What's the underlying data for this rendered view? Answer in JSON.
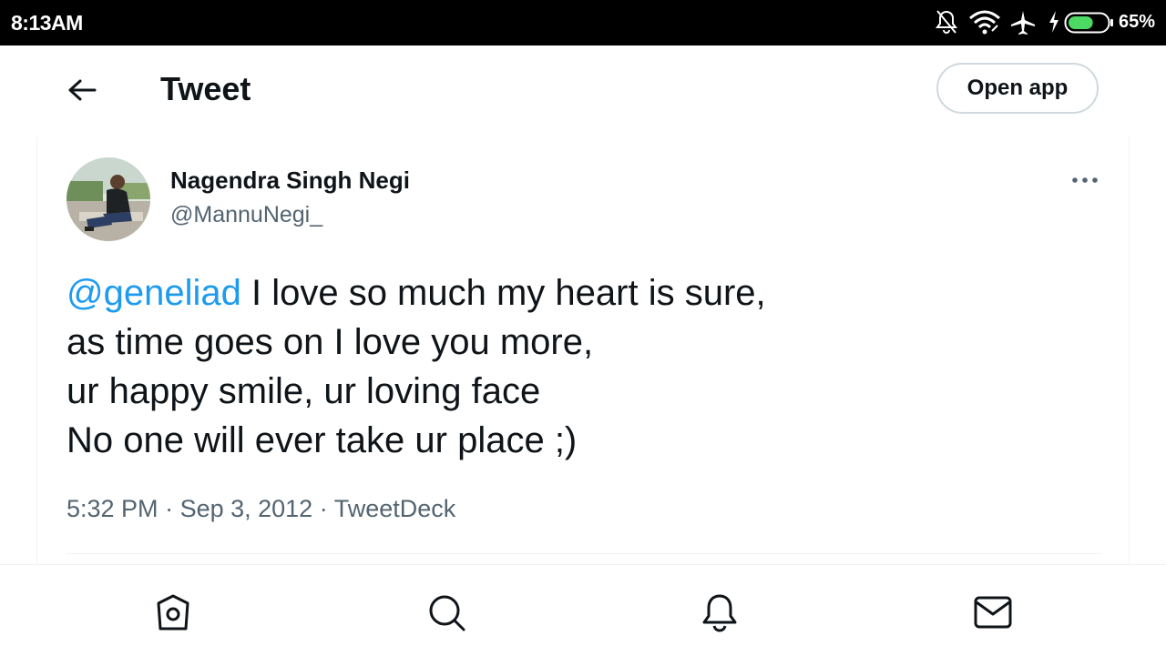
{
  "status_bar": {
    "time": "8:13AM",
    "battery_percent": "65%",
    "icons": [
      "bell-off-icon",
      "wifi-icon",
      "airplane-icon",
      "charging-icon",
      "battery-icon"
    ],
    "battery_fill_fraction": 0.65,
    "battery_color": "#4cd964"
  },
  "header": {
    "title": "Tweet",
    "open_app_label": "Open app"
  },
  "tweet": {
    "author_name": "Nagendra Singh Negi",
    "author_handle": "@MannuNegi_",
    "mention": "@geneliad",
    "line1_rest": " I love so much my heart is sure,",
    "line2": "as time goes on I love you more,",
    "line3": "ur happy smile, ur loving face",
    "line4": "No one will ever take ur place ;)",
    "time": "5:32 PM",
    "date": "Sep 3, 2012",
    "source": "TweetDeck",
    "separator": " · "
  },
  "bottom_nav": {
    "items": [
      "home-icon",
      "search-icon",
      "notifications-icon",
      "messages-icon"
    ]
  },
  "colors": {
    "accent": "#1d9bf0",
    "text_primary": "#0f1419",
    "text_secondary": "#536471",
    "border": "#cfd9de"
  }
}
